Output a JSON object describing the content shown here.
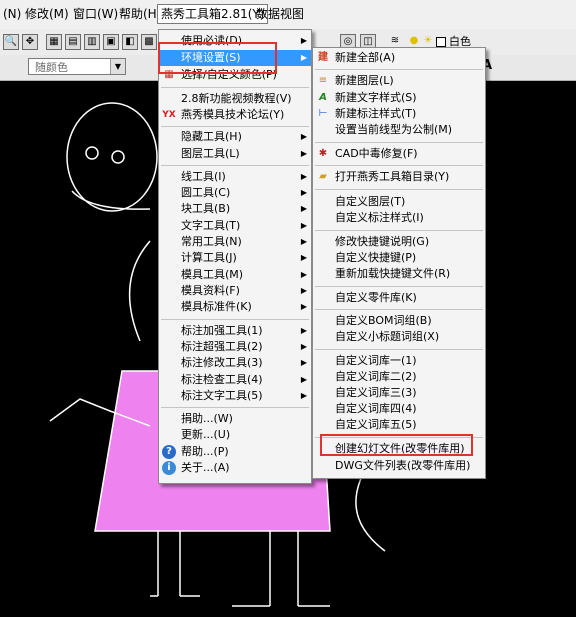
{
  "menubar": {
    "items": [
      "(N)",
      "修改(M)",
      "窗口(W)",
      "帮助(H)",
      "燕秀工具箱2.81(Y)",
      "数据视图"
    ]
  },
  "toolbar": {
    "color_combo": "随颜色",
    "layer_combo": "白色"
  },
  "main_menu": {
    "items": [
      {
        "label": "使用必读(D)",
        "arrow": true
      },
      {
        "label": "环境设置(S)",
        "arrow": true,
        "selected": true
      },
      {
        "label": "选择/自定义颜色(P)",
        "arrow": false
      },
      {
        "label": "2.8新功能视频教程(V)",
        "arrow": false
      },
      {
        "label": "燕秀模具技术论坛(Y)",
        "arrow": false,
        "icon": "YX"
      },
      {
        "label": "隐藏工具(H)",
        "arrow": true
      },
      {
        "label": "图层工具(L)",
        "arrow": true
      },
      {
        "label": "线工具(I)",
        "arrow": true
      },
      {
        "label": "圆工具(C)",
        "arrow": true
      },
      {
        "label": "块工具(B)",
        "arrow": true
      },
      {
        "label": "文字工具(T)",
        "arrow": true
      },
      {
        "label": "常用工具(N)",
        "arrow": true
      },
      {
        "label": "计算工具(J)",
        "arrow": true
      },
      {
        "label": "模具工具(M)",
        "arrow": true
      },
      {
        "label": "模具资料(F)",
        "arrow": true
      },
      {
        "label": "模具标准件(K)",
        "arrow": true
      },
      {
        "label": "标注加强工具(1)",
        "arrow": true
      },
      {
        "label": "标注超强工具(2)",
        "arrow": true
      },
      {
        "label": "标注修改工具(3)",
        "arrow": true
      },
      {
        "label": "标注检查工具(4)",
        "arrow": true
      },
      {
        "label": "标注文字工具(5)",
        "arrow": true
      },
      {
        "label": "捐助...(W)",
        "arrow": false
      },
      {
        "label": "更新...(U)",
        "arrow": false
      },
      {
        "label": "帮助...(P)",
        "arrow": false,
        "icon": "?"
      },
      {
        "label": "关于...(A)",
        "arrow": false,
        "icon": "i"
      }
    ]
  },
  "sub_menu": {
    "items": [
      {
        "label": "新建全部(A)",
        "icon": "new"
      },
      {
        "label": "新建图层(L)",
        "icon": "layer"
      },
      {
        "label": "新建文字样式(S)",
        "icon": "A"
      },
      {
        "label": "新建标注样式(T)",
        "icon": "dim"
      },
      {
        "label": "设置当前线型为公制(M)",
        "icon": ""
      },
      {
        "label": "CAD中毒修复(F)",
        "icon": "bug"
      },
      {
        "label": "打开燕秀工具箱目录(Y)",
        "icon": "folder"
      },
      {
        "label": "自定义图层(T)",
        "icon": ""
      },
      {
        "label": "自定义标注样式(I)",
        "icon": ""
      },
      {
        "label": "修改快捷键说明(G)",
        "icon": ""
      },
      {
        "label": "自定义快捷键(P)",
        "icon": ""
      },
      {
        "label": "重新加载快捷键文件(R)",
        "icon": ""
      },
      {
        "label": "自定义零件库(K)",
        "icon": ""
      },
      {
        "label": "自定义BOM词组(B)",
        "icon": ""
      },
      {
        "label": "自定义小标题词组(X)",
        "icon": ""
      },
      {
        "label": "自定义词库一(1)",
        "icon": ""
      },
      {
        "label": "自定义词库二(2)",
        "icon": ""
      },
      {
        "label": "自定义词库三(3)",
        "icon": ""
      },
      {
        "label": "自定义词库四(4)",
        "icon": ""
      },
      {
        "label": "自定义词库五(5)",
        "icon": ""
      },
      {
        "label": "创建幻灯文件(改零件库用)",
        "icon": ""
      },
      {
        "label": "DWG文件列表(改零件库用)",
        "icon": ""
      }
    ]
  },
  "colors": {
    "menu_bg": "#f4f4f4",
    "selected": "#3399ff",
    "highlight_box": "#e0322e",
    "pig_pink": "#ee82ee"
  }
}
